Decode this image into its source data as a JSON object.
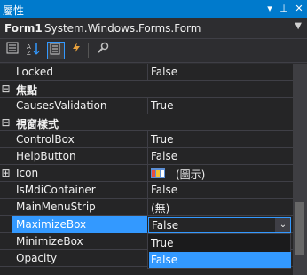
{
  "window": {
    "title": "屬性",
    "buttons": [
      "▾",
      "⊥",
      "✕"
    ]
  },
  "object_selector": {
    "name": "Form1",
    "type": "System.Windows.Forms.Form"
  },
  "toolbar": {
    "icons": [
      "categorized-icon",
      "alphabetical-icon",
      "properties-icon",
      "events-icon",
      "property-pages-icon"
    ]
  },
  "rows": [
    {
      "kind": "prop",
      "name": "Locked",
      "value": "False"
    },
    {
      "kind": "cat",
      "gutter": "⊟",
      "name": "焦點"
    },
    {
      "kind": "prop",
      "name": "CausesValidation",
      "value": "True"
    },
    {
      "kind": "cat",
      "gutter": "⊟",
      "name": "視窗樣式"
    },
    {
      "kind": "prop",
      "name": "ControlBox",
      "value": "True"
    },
    {
      "kind": "prop",
      "name": "HelpButton",
      "value": "False"
    },
    {
      "kind": "prop",
      "gutter": "⊞",
      "name": "Icon",
      "value": "(圖示)"
    },
    {
      "kind": "prop",
      "name": "IsMdiContainer",
      "value": "False"
    },
    {
      "kind": "prop",
      "name": "MainMenuStrip",
      "value": "(無)"
    },
    {
      "kind": "prop",
      "name": "MaximizeBox",
      "value": "False"
    },
    {
      "kind": "prop",
      "name": "MinimizeBox",
      "value": ""
    },
    {
      "kind": "prop",
      "name": "Opacity",
      "value": ""
    }
  ],
  "editor": {
    "value": "False"
  },
  "dropdown": {
    "options": [
      "True",
      "False"
    ],
    "selected": "False"
  },
  "colors": {
    "accent": "#007acc",
    "selection": "#3399ff",
    "background": "#252526"
  }
}
